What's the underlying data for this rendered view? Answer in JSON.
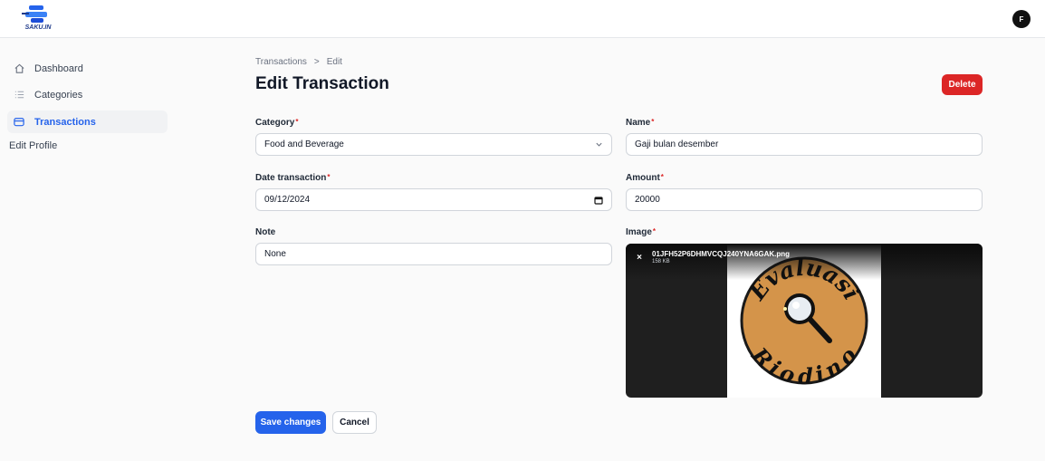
{
  "header": {
    "logo_text": "SAKU.IN",
    "avatar_initial": "F"
  },
  "sidebar": {
    "items": [
      {
        "label": "Dashboard",
        "icon": "home-icon"
      },
      {
        "label": "Categories",
        "icon": "list-icon"
      },
      {
        "label": "Transactions",
        "icon": "wallet-icon",
        "active": true
      }
    ],
    "edit_profile": "Edit Profile"
  },
  "breadcrumb": {
    "parent": "Transactions",
    "separator": ">",
    "current": "Edit"
  },
  "page": {
    "title": "Edit Transaction",
    "delete_label": "Delete"
  },
  "form": {
    "category": {
      "label": "Category",
      "required": "*",
      "value": "Food and Beverage"
    },
    "name": {
      "label": "Name",
      "required": "*",
      "value": "Gaji bulan desember"
    },
    "date": {
      "label": "Date transaction",
      "required": "*",
      "value": "09/12/2024"
    },
    "amount": {
      "label": "Amount",
      "required": "*",
      "value": "20000"
    },
    "note": {
      "label": "Note",
      "value": "None"
    },
    "image": {
      "label": "Image",
      "required": "*",
      "file_name": "01JFH52P6DHMVCQJ240YNA6GAK.png",
      "file_size": "158 KB",
      "close": "×",
      "picture_text_top": "Evaluasi",
      "picture_text_bottom": "Riodino"
    }
  },
  "actions": {
    "save_label": "Save changes",
    "cancel_label": "Cancel"
  },
  "colors": {
    "primary": "#2563eb",
    "danger": "#dc2626",
    "badge_brown": "#d4944a"
  }
}
